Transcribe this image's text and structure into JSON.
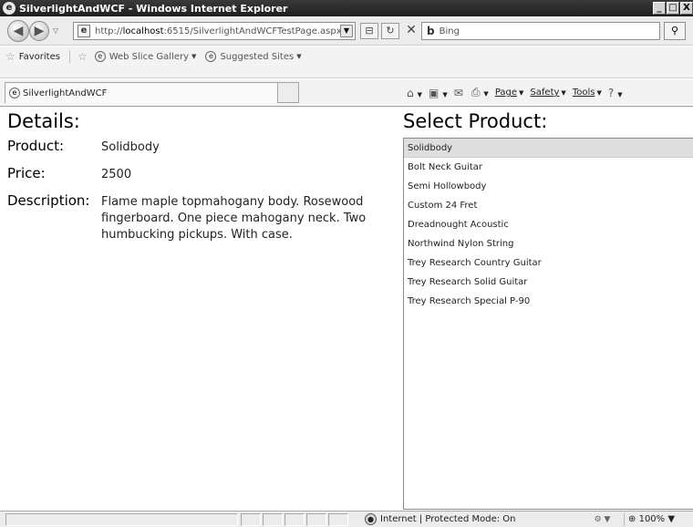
{
  "window": {
    "title": "SilverlightAndWCF - Windows Internet Explorer",
    "controls": [
      "_",
      "□",
      "X"
    ]
  },
  "navigation": {
    "url_prefix": "http://",
    "url_host": "localhost",
    "url_rest": ":6515/SilverlightAndWCFTestPage.aspx",
    "search_placeholder": "Bing",
    "search_icon": "magnifier-icon"
  },
  "favorites_bar": {
    "favorites_label": "Favorites",
    "links": [
      "Web Slice Gallery",
      "Suggested Sites"
    ]
  },
  "tab": {
    "title": "SilverlightAndWCF"
  },
  "command_bar": {
    "page": "Page",
    "safety": "Safety",
    "tools": "Tools"
  },
  "details": {
    "heading": "Details:",
    "product_label": "Product:",
    "product_value": "Solidbody",
    "price_label": "Price:",
    "price_value": "2500",
    "description_label": "Description:",
    "description_value": "Flame maple topmahogany body. Rosewood fingerboard. One piece mahogany neck. Two humbucking pickups. With case."
  },
  "products": {
    "heading": "Select Product:",
    "selected_index": 0,
    "items": [
      "Solidbody",
      "Bolt Neck Guitar",
      "Semi Hollowbody",
      "Custom 24 Fret",
      "Dreadnought Acoustic",
      "Northwind Nylon String",
      "Trey Research Country Guitar",
      "Trey Research Solid Guitar",
      "Trey Research Special P-90"
    ]
  },
  "status_bar": {
    "zone_text": "Internet | Protected Mode: On",
    "zoom": "100%"
  }
}
